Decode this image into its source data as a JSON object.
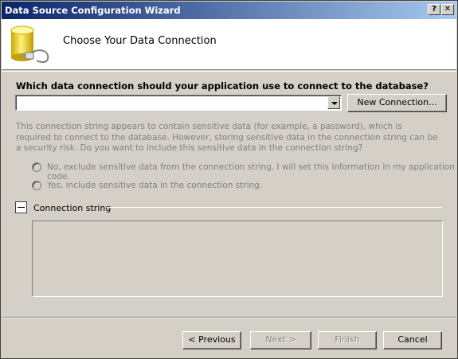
{
  "window": {
    "title": "Data Source Configuration Wizard",
    "help_label": "?",
    "close_label": "✕"
  },
  "header": {
    "heading": "Choose Your Data Connection",
    "icon": "database-connection-icon"
  },
  "connection": {
    "question": "Which data connection should your application use to connect to the database?",
    "selected_value": "",
    "new_connection_label": "New Connection..."
  },
  "sensitive": {
    "description": "This connection string appears to contain sensitive data (for example, a password), which is required to connect to the database. However, storing sensitive data in the connection string can be a security risk. Do you want to include this sensitive data in the connection string?",
    "option_no": "No, exclude sensitive data from the connection string. I will set this information in my application code.",
    "option_yes": "Yes, include sensitive data in the connection string."
  },
  "connection_string": {
    "label": "Connection string",
    "value": ""
  },
  "footer": {
    "previous_label": "< Previous",
    "next_label": "Next >",
    "finish_label": "Finish",
    "cancel_label": "Cancel"
  },
  "colors": {
    "title_gradient_start": "#0a246a",
    "title_gradient_end": "#a6caf0",
    "face": "#d4d0c8",
    "disabled_text": "#808080"
  }
}
